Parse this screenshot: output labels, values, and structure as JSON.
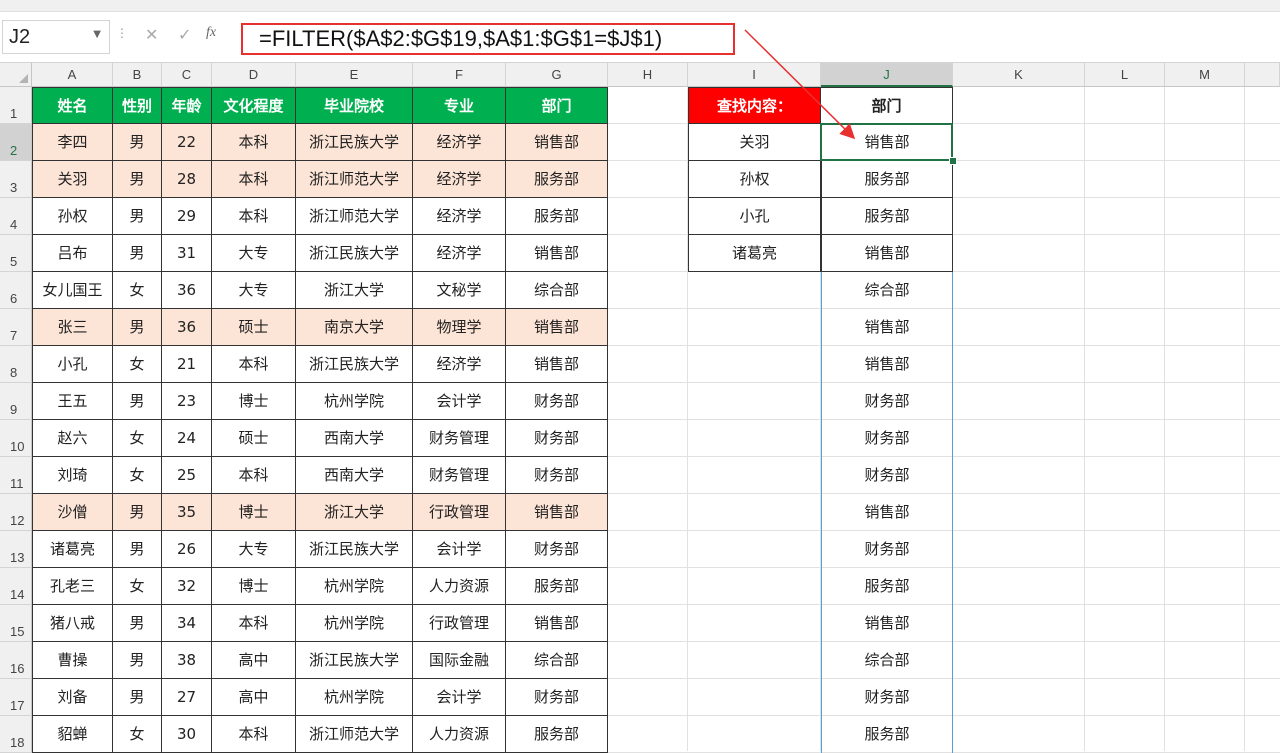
{
  "name_box": "J2",
  "formula": "=FILTER($A$2:$G$19,$A$1:$G$1=$J$1)",
  "columns": [
    "A",
    "B",
    "C",
    "D",
    "E",
    "F",
    "G",
    "H",
    "I",
    "J",
    "K",
    "L",
    "M"
  ],
  "rows": [
    "1",
    "2",
    "3",
    "4",
    "5",
    "6",
    "7",
    "8",
    "9",
    "10",
    "11",
    "12",
    "13",
    "14",
    "15",
    "16",
    "17",
    "18"
  ],
  "table_headers": [
    "姓名",
    "性别",
    "年龄",
    "文化程度",
    "毕业院校",
    "专业",
    "部门"
  ],
  "table_rows": [
    [
      "李四",
      "男",
      "22",
      "本科",
      "浙江民族大学",
      "经济学",
      "销售部"
    ],
    [
      "关羽",
      "男",
      "28",
      "本科",
      "浙江师范大学",
      "经济学",
      "服务部"
    ],
    [
      "孙权",
      "男",
      "29",
      "本科",
      "浙江师范大学",
      "经济学",
      "服务部"
    ],
    [
      "吕布",
      "男",
      "31",
      "大专",
      "浙江民族大学",
      "经济学",
      "销售部"
    ],
    [
      "女儿国王",
      "女",
      "36",
      "大专",
      "浙江大学",
      "文秘学",
      "综合部"
    ],
    [
      "张三",
      "男",
      "36",
      "硕士",
      "南京大学",
      "物理学",
      "销售部"
    ],
    [
      "小孔",
      "女",
      "21",
      "本科",
      "浙江民族大学",
      "经济学",
      "销售部"
    ],
    [
      "王五",
      "男",
      "23",
      "博士",
      "杭州学院",
      "会计学",
      "财务部"
    ],
    [
      "赵六",
      "女",
      "24",
      "硕士",
      "西南大学",
      "财务管理",
      "财务部"
    ],
    [
      "刘琦",
      "女",
      "25",
      "本科",
      "西南大学",
      "财务管理",
      "财务部"
    ],
    [
      "沙僧",
      "男",
      "35",
      "博士",
      "浙江大学",
      "行政管理",
      "销售部"
    ],
    [
      "诸葛亮",
      "男",
      "26",
      "大专",
      "浙江民族大学",
      "会计学",
      "财务部"
    ],
    [
      "孔老三",
      "女",
      "32",
      "博士",
      "杭州学院",
      "人力资源",
      "服务部"
    ],
    [
      "猪八戒",
      "男",
      "34",
      "本科",
      "杭州学院",
      "行政管理",
      "销售部"
    ],
    [
      "曹操",
      "男",
      "38",
      "高中",
      "浙江民族大学",
      "国际金融",
      "综合部"
    ],
    [
      "刘备",
      "男",
      "27",
      "高中",
      "杭州学院",
      "会计学",
      "财务部"
    ],
    [
      "貂蝉",
      "女",
      "30",
      "本科",
      "浙江师范大学",
      "人力资源",
      "服务部"
    ]
  ],
  "highlighted_rows": [
    2,
    3,
    7,
    12
  ],
  "lookup": {
    "label": "查找内容：",
    "items": [
      "关羽",
      "孙权",
      "小孔",
      "诸葛亮"
    ]
  },
  "result": {
    "header": "部门",
    "values": [
      "销售部",
      "服务部",
      "服务部",
      "销售部",
      "综合部",
      "销售部",
      "销售部",
      "财务部",
      "财务部",
      "财务部",
      "销售部",
      "财务部",
      "服务部",
      "销售部",
      "综合部",
      "财务部",
      "服务部"
    ]
  },
  "colors": {
    "header_green": "#00b050",
    "highlight_peach": "#fce4d6",
    "lookup_red": "#ff0000",
    "annotation_red": "#e8302f",
    "selection_green": "#217346"
  }
}
